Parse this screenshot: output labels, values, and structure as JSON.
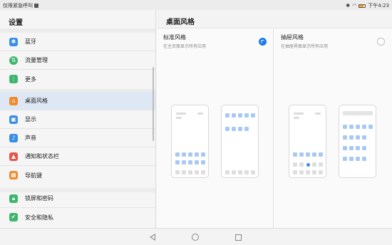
{
  "status_bar": {
    "left_text": "仅限紧急呼叫",
    "time": "下午4:23",
    "battery_color": "#f2a31b",
    "icons": [
      "sim-icon",
      "bluetooth-icon",
      "wifi-icon",
      "battery-icon"
    ]
  },
  "sidebar": {
    "title": "设置",
    "groups": [
      {
        "items": [
          {
            "label": "蓝牙",
            "icon": "bluetooth-icon",
            "color": "#3a8ee6"
          },
          {
            "label": "流量管理",
            "icon": "data-usage-icon",
            "color": "#3fb56d"
          },
          {
            "label": "更多",
            "icon": "more-icon",
            "color": "#3fb56d"
          }
        ]
      },
      {
        "items": [
          {
            "label": "桌面风格",
            "icon": "home-icon",
            "color": "#f08a2b",
            "selected": true
          },
          {
            "label": "显示",
            "icon": "display-icon",
            "color": "#3a8ee6"
          },
          {
            "label": "声音",
            "icon": "sound-icon",
            "color": "#3a8ee6"
          },
          {
            "label": "通知和状态栏",
            "icon": "notification-icon",
            "color": "#e8554a"
          },
          {
            "label": "导航键",
            "icon": "navigation-icon",
            "color": "#f08a2b"
          }
        ]
      },
      {
        "items": [
          {
            "label": "锁屏和密码",
            "icon": "lock-icon",
            "color": "#3fb56d"
          },
          {
            "label": "安全和隐私",
            "icon": "shield-icon",
            "color": "#3fb56d"
          }
        ]
      }
    ]
  },
  "content": {
    "title": "桌面风格",
    "options": [
      {
        "title": "标准风格",
        "subtitle": "在主页面显示所有应用",
        "selected": true
      },
      {
        "title": "抽屉风格",
        "subtitle": "在抽屉界面显示所有应用",
        "selected": false
      }
    ]
  },
  "nav_bar": {
    "buttons": [
      "back-icon",
      "home-icon",
      "recent-apps-icon"
    ]
  }
}
